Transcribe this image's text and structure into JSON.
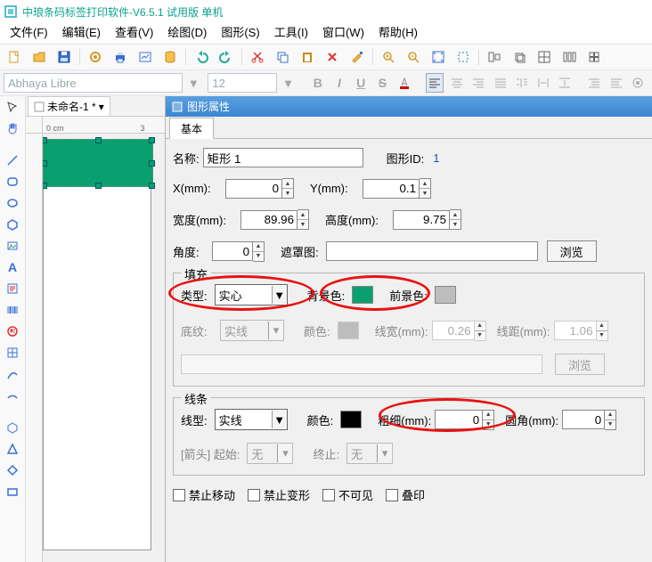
{
  "title": "中琅条码标签打印软件-V6.5.1 试用版 单机",
  "menu": [
    "文件(F)",
    "编辑(E)",
    "查看(V)",
    "绘图(D)",
    "图形(S)",
    "工具(I)",
    "窗口(W)",
    "帮助(H)"
  ],
  "font": {
    "name": "Abhaya Libre",
    "size": "12"
  },
  "doc": {
    "tab": "未命名-1 *",
    "close": "×"
  },
  "ruler": {
    "unit": "0 cm",
    "max": "3"
  },
  "panel": {
    "title": "图形属性",
    "tab": "基本",
    "name_lbl": "名称:",
    "name": "矩形 1",
    "id_lbl": "图形ID:",
    "id": "1",
    "x_lbl": "X(mm):",
    "x": "0",
    "y_lbl": "Y(mm):",
    "y": "0.1",
    "w_lbl": "宽度(mm):",
    "w": "89.96",
    "h_lbl": "高度(mm):",
    "h": "9.75",
    "ang_lbl": "角度:",
    "ang": "0",
    "mask_lbl": "遮罩图:",
    "mask": "",
    "browse": "浏览",
    "fill": {
      "title": "填充",
      "type_lbl": "类型:",
      "type": "实心",
      "bg_lbl": "背景色:",
      "fg_lbl": "前景色:",
      "bg": "#0a9f6e",
      "fg": "#bdbdbd",
      "pat_lbl": "底纹:",
      "pat": "实线",
      "col_lbl": "颜色:",
      "lw_lbl": "线宽(mm):",
      "lw": "0.26",
      "ld_lbl": "线距(mm):",
      "ld": "1.06"
    },
    "line": {
      "title": "线条",
      "type_lbl": "线型:",
      "type": "实线",
      "col_lbl": "颜色:",
      "col": "#000000",
      "thick_lbl": "粗细(mm):",
      "thick": "0",
      "rad_lbl": "圆角(mm):",
      "rad": "0",
      "arrow_lbl": "[箭头] 起始:",
      "arrow_s": "无",
      "end_lbl": "终止:",
      "arrow_e": "无"
    },
    "locks": {
      "a": "禁止移动",
      "b": "禁止变形",
      "c": "不可见",
      "d": "叠印"
    }
  }
}
